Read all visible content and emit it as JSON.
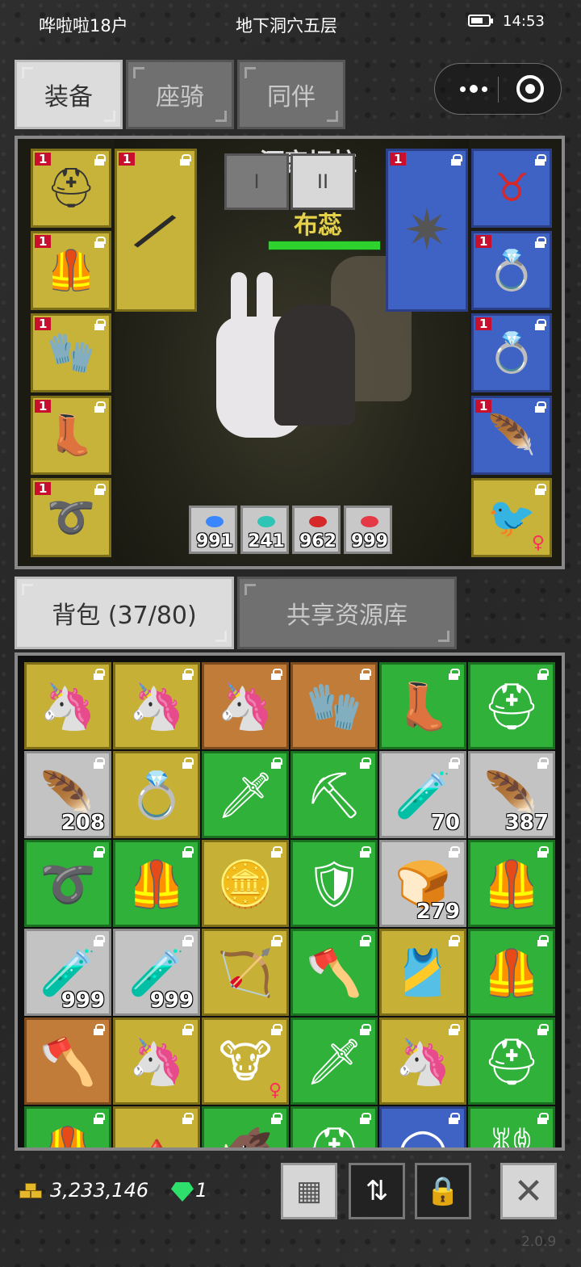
{
  "status_bar": {
    "user": "哗啦啦18户",
    "location": "地下洞穴五层",
    "time": "14:53"
  },
  "top_tabs": [
    {
      "label": "装备",
      "active": true
    },
    {
      "label": "座骑",
      "active": false
    },
    {
      "label": "同伴",
      "active": false
    }
  ],
  "equipment": {
    "stage_title": "河宫坛柱",
    "hero_name": "布蕊",
    "pager": [
      "I",
      "II"
    ],
    "left_slots": [
      {
        "level": "1",
        "icon": "helmet-icon",
        "glyph": "⛑"
      },
      {
        "level": "1",
        "icon": "armor-icon",
        "glyph": "🦺"
      },
      {
        "level": "1",
        "icon": "gauntlet-icon",
        "glyph": "🧤"
      },
      {
        "level": "1",
        "icon": "boots-icon",
        "glyph": "👢"
      },
      {
        "level": "1",
        "icon": "belt-icon",
        "glyph": "➰"
      }
    ],
    "weapon_slot": {
      "level": "1",
      "icon": "spear-icon",
      "glyph": "/"
    },
    "offhand_slot": {
      "level": "1",
      "icon": "morningstar-icon",
      "glyph": "✷"
    },
    "right_slots": [
      {
        "level": "",
        "icon": "necklace-icon",
        "glyph": "♉",
        "color": "blue"
      },
      {
        "level": "1",
        "icon": "ring-icon",
        "glyph": "💍",
        "color": "blue"
      },
      {
        "level": "1",
        "icon": "ring-icon",
        "glyph": "💍",
        "color": "blue"
      },
      {
        "level": "1",
        "icon": "wings-icon",
        "glyph": "🪶",
        "color": "blue"
      },
      {
        "level": "",
        "icon": "pet-bird-icon",
        "glyph": "🐦",
        "color": "yellow"
      }
    ],
    "consumables": [
      {
        "count": "991",
        "icon": "blue-feather-icon",
        "color": "#3a86ff"
      },
      {
        "count": "241",
        "icon": "teal-feather-icon",
        "color": "#2ec4b6"
      },
      {
        "count": "962",
        "icon": "potion-icon",
        "color": "#d62828"
      },
      {
        "count": "999",
        "icon": "red-feather-icon",
        "color": "#e63946"
      }
    ]
  },
  "bag_tabs": [
    {
      "label": "背包 (37/80)",
      "active": true
    },
    {
      "label": "共享资源库",
      "active": false
    }
  ],
  "inventory": [
    {
      "color": "yellow",
      "icon": "unicorn-mount-icon",
      "glyph": "🦄",
      "count": "",
      "female": false
    },
    {
      "color": "yellow",
      "icon": "unicorn-mount-icon",
      "glyph": "🦄",
      "count": "",
      "female": false
    },
    {
      "color": "orange",
      "icon": "unicorn-knight-icon",
      "glyph": "🦄",
      "count": "",
      "female": false
    },
    {
      "color": "orange",
      "icon": "glove-icon",
      "glyph": "🧤",
      "count": "",
      "female": false
    },
    {
      "color": "green",
      "icon": "boots-icon",
      "glyph": "👢",
      "count": "",
      "female": false
    },
    {
      "color": "green",
      "icon": "helmet-icon",
      "glyph": "⛑",
      "count": "",
      "female": false
    },
    {
      "color": "gray",
      "icon": "red-feather-icon",
      "glyph": "🪶",
      "count": "208",
      "female": false
    },
    {
      "color": "yellow",
      "icon": "ring-icon",
      "glyph": "💍",
      "count": "",
      "female": false
    },
    {
      "color": "green",
      "icon": "sword-icon",
      "glyph": "🗡",
      "count": "",
      "female": false
    },
    {
      "color": "green",
      "icon": "pickaxe-icon",
      "glyph": "⛏",
      "count": "",
      "female": false
    },
    {
      "color": "gray",
      "icon": "potion-icon",
      "glyph": "🧪",
      "count": "70",
      "female": false
    },
    {
      "color": "gray",
      "icon": "blue-feather-icon",
      "glyph": "🪶",
      "count": "387",
      "female": false
    },
    {
      "color": "green",
      "icon": "belt-icon",
      "glyph": "➰",
      "count": "",
      "female": false
    },
    {
      "color": "green",
      "icon": "leather-armor-icon",
      "glyph": "🦺",
      "count": "",
      "female": false
    },
    {
      "color": "yellow",
      "icon": "coin-icon",
      "glyph": "🪙",
      "count": "",
      "female": false
    },
    {
      "color": "green",
      "icon": "shield-icon",
      "glyph": "🛡",
      "count": "",
      "female": false
    },
    {
      "color": "gray",
      "icon": "bread-icon",
      "glyph": "🍞",
      "count": "279",
      "female": false
    },
    {
      "color": "green",
      "icon": "plate-armor-icon",
      "glyph": "🦺",
      "count": "",
      "female": false
    },
    {
      "color": "gray",
      "icon": "potion-icon",
      "glyph": "🧪",
      "count": "999",
      "female": false
    },
    {
      "color": "gray",
      "icon": "potion-icon",
      "glyph": "🧪",
      "count": "999",
      "female": false
    },
    {
      "color": "yellow",
      "icon": "crossbow-icon",
      "glyph": "🏹",
      "count": "",
      "female": false
    },
    {
      "color": "green",
      "icon": "red-axe-icon",
      "glyph": "🪓",
      "count": "",
      "female": false
    },
    {
      "color": "yellow",
      "icon": "chest-armor-icon",
      "glyph": "🎽",
      "count": "",
      "female": false
    },
    {
      "color": "green",
      "icon": "leather-armor-icon",
      "glyph": "🦺",
      "count": "",
      "female": false
    },
    {
      "color": "orange",
      "icon": "axe-icon",
      "glyph": "🪓",
      "count": "",
      "female": false
    },
    {
      "color": "yellow",
      "icon": "unicorn-mount-icon",
      "glyph": "🦄",
      "count": "",
      "female": false
    },
    {
      "color": "yellow",
      "icon": "cow-pet-icon",
      "glyph": "🐮",
      "count": "",
      "female": true
    },
    {
      "color": "green",
      "icon": "sword-icon",
      "glyph": "🗡",
      "count": "",
      "female": false
    },
    {
      "color": "yellow",
      "icon": "unicorn-mount-icon",
      "glyph": "🦄",
      "count": "",
      "female": false
    },
    {
      "color": "green",
      "icon": "helmet-icon",
      "glyph": "⛑",
      "count": "",
      "female": false
    },
    {
      "color": "green",
      "icon": "armor-icon",
      "glyph": "🦺",
      "count": "",
      "female": false
    },
    {
      "color": "yellow",
      "icon": "red-item-icon",
      "glyph": "🔺",
      "count": "",
      "female": false
    },
    {
      "color": "green",
      "icon": "beast-icon",
      "glyph": "🐗",
      "count": "",
      "female": false
    },
    {
      "color": "green",
      "icon": "helmet-icon",
      "glyph": "⛑",
      "count": "",
      "female": false
    },
    {
      "color": "blue",
      "icon": "ring-icon",
      "glyph": "◯",
      "count": "",
      "female": false
    },
    {
      "color": "green",
      "icon": "chain-icon",
      "glyph": "⛓",
      "count": "",
      "female": false
    }
  ],
  "currency": {
    "gold": "3,233,146",
    "gems": "1"
  },
  "version": "2.0.9"
}
